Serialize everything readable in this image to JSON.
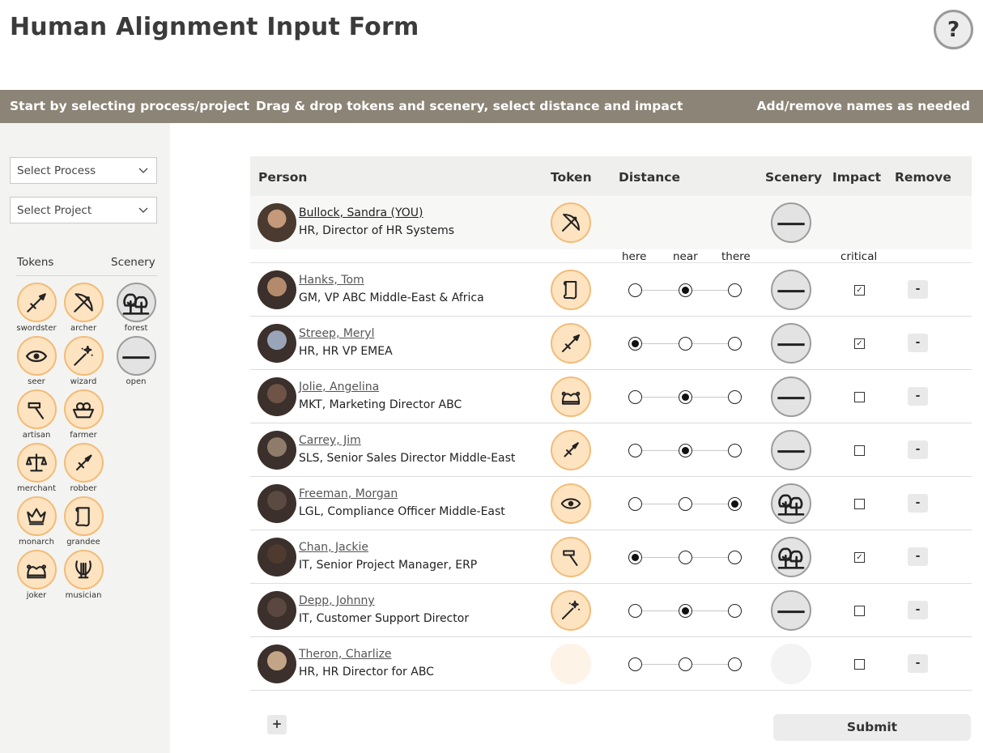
{
  "title": "Human Alignment Input Form",
  "help_label": "?",
  "banner": {
    "step1": "Start by selecting process/project",
    "step2": "Drag & drop tokens and scenery, select distance and impact",
    "step3": "Add/remove names as needed"
  },
  "sidebar": {
    "process_placeholder": "Select Process",
    "project_placeholder": "Select Project",
    "tokens_heading": "Tokens",
    "scenery_heading": "Scenery",
    "tokens": [
      {
        "label": "swordster",
        "icon": "sword-icon"
      },
      {
        "label": "archer",
        "icon": "bow-icon"
      },
      {
        "label": "seer",
        "icon": "eye-icon"
      },
      {
        "label": "wizard",
        "icon": "wand-icon"
      },
      {
        "label": "artisan",
        "icon": "hammer-icon"
      },
      {
        "label": "farmer",
        "icon": "basket-icon"
      },
      {
        "label": "merchant",
        "icon": "scales-icon"
      },
      {
        "label": "robber",
        "icon": "dagger-icon"
      },
      {
        "label": "monarch",
        "icon": "crown-icon"
      },
      {
        "label": "grandee",
        "icon": "scroll-icon"
      },
      {
        "label": "joker",
        "icon": "jester-hat-icon"
      },
      {
        "label": "musician",
        "icon": "lyre-icon"
      }
    ],
    "scenery": [
      {
        "label": "forest",
        "icon": "trees-icon"
      },
      {
        "label": "open",
        "icon": "horizon-line-icon"
      }
    ]
  },
  "table": {
    "headers": {
      "person": "Person",
      "token": "Token",
      "distance": "Distance",
      "scenery": "Scenery",
      "impact": "Impact",
      "remove": "Remove"
    },
    "distance_labels": [
      "here",
      "near",
      "there"
    ],
    "impact_label": "critical",
    "me": {
      "name": "Bullock, Sandra (YOU)",
      "role": "HR, Director of HR Systems",
      "token": "bow-icon",
      "scenery": "horizon-line-icon"
    },
    "rows": [
      {
        "name": "Hanks, Tom",
        "role": "GM, VP ABC Middle-East & Africa",
        "token": "scroll-icon",
        "distance": "near",
        "scenery": "horizon-line-icon",
        "critical": true
      },
      {
        "name": "Streep, Meryl",
        "role": "HR, HR VP EMEA",
        "token": "sword-icon",
        "distance": "here",
        "scenery": "horizon-line-icon",
        "critical": true
      },
      {
        "name": "Jolie, Angelina",
        "role": "MKT, Marketing Director ABC",
        "token": "jester-hat-icon",
        "distance": "near",
        "scenery": "horizon-line-icon",
        "critical": false
      },
      {
        "name": "Carrey, Jim",
        "role": "SLS, Senior Sales Director Middle-East",
        "token": "dagger-icon",
        "distance": "near",
        "scenery": "horizon-line-icon",
        "critical": false
      },
      {
        "name": "Freeman, Morgan",
        "role": "LGL, Compliance Officer Middle-East",
        "token": "eye-icon",
        "distance": "there",
        "scenery": "trees-icon",
        "critical": false
      },
      {
        "name": "Chan, Jackie",
        "role": "IT, Senior Project Manager, ERP",
        "token": "hammer-icon",
        "distance": "here",
        "scenery": "trees-icon",
        "critical": true
      },
      {
        "name": "Depp, Johnny",
        "role": "IT, Customer Support Director",
        "token": "wand-icon",
        "distance": "near",
        "scenery": "horizon-line-icon",
        "critical": false
      },
      {
        "name": "Theron, Charlize",
        "role": "HR, HR Director for ABC",
        "token": "",
        "distance": "",
        "scenery": "",
        "critical": false
      }
    ],
    "remove_label": "-",
    "add_label": "+",
    "submit_label": "Submit"
  }
}
